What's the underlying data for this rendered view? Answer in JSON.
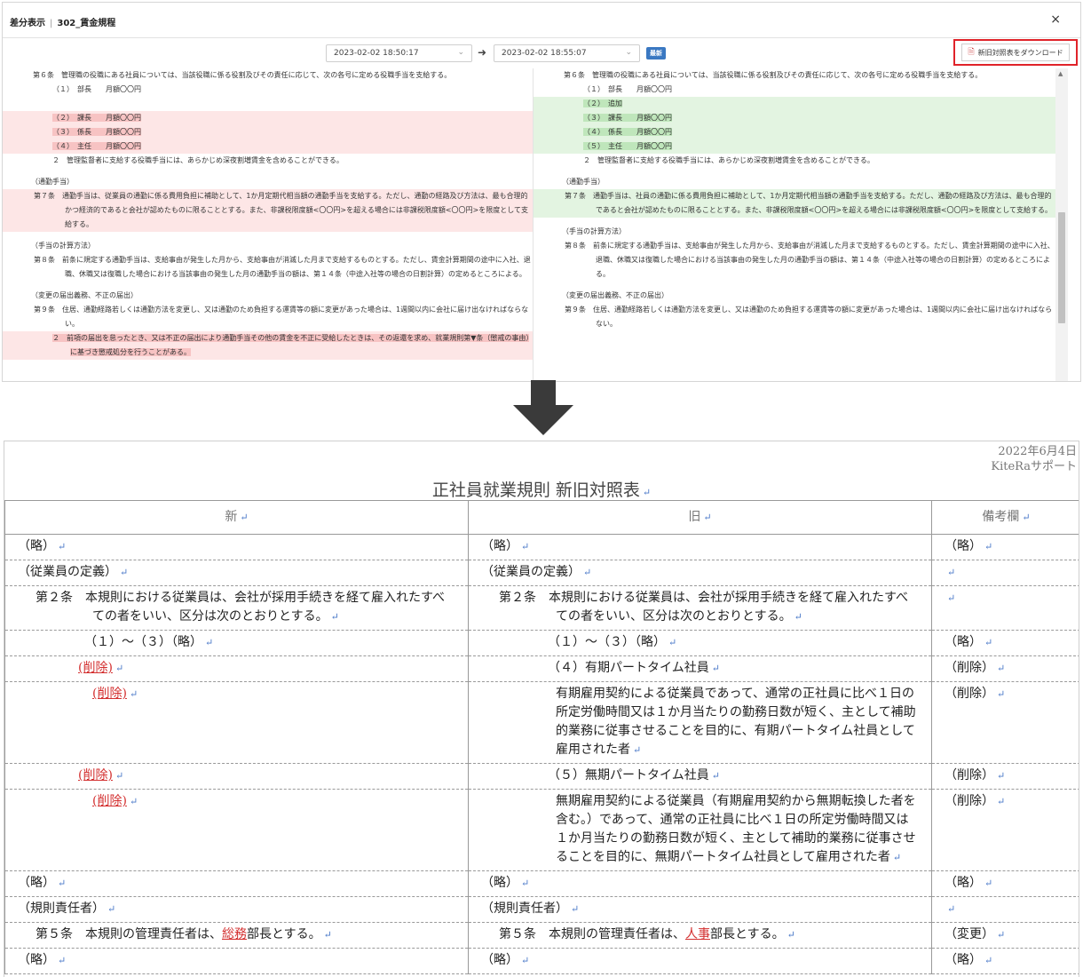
{
  "dialog": {
    "title": "差分表示",
    "doc_name": "302_賃金規程",
    "close_glyph": "×",
    "date_from": "2023-02-02 18:50:17",
    "date_to": "2023-02-02 18:55:07",
    "latest_badge": "最新",
    "download_label": "新旧対照表をダウンロード"
  },
  "left_pane": {
    "art6": "第６条　管理職の役職にある社員については、当該役職に係る役割及びその責任に応じて、次の各号に定める役職手当を支給する。",
    "l1": "（１）　部長　　月額〇〇円",
    "l2": "（２）　課長　　月額〇〇円",
    "l3": "（３）　係長　　月額〇〇円",
    "l4": "（４）　主任　　月額〇〇円",
    "art6_2": "２　管理監督者に支給する役職手当には、あらかじめ深夜割増賃金を含めることができる。",
    "sec7": "（通勤手当）",
    "art7": "第７条　通勤手当は、従業員の通勤に係る費用負担に補助として、1か月定期代相当額の通勤手当を支給する。ただし、通勤の経路及び方法は、最も合理的かつ経済的であると会社が認めたものに限ることとする。また、非課税限度額<〇〇円>を超える場合には非課税限度額<〇〇円>を限度として支給する。",
    "sec8": "（手当の計算方法）",
    "art8": "第８条　前条に規定する通勤手当は、支給事由が発生した月から、支給事由が消滅した月まで支給するものとする。ただし、賃金計算期間の途中に入社、退職、休職又は復職した場合における当該事由の発生した月の通勤手当の額は、第１４条（中途入社等の場合の日割計算）の定めるところによる。",
    "sec9": "（変更の届出義務、不正の届出）",
    "art9": "第９条　住居、通勤経路若しくは通勤方法を変更し、又は通勤のため負担する運賃等の額に変更があった場合は、1週間以内に会社に届け出なければならない。",
    "art9_2": "２　前項の届出を怠ったとき、又は不正の届出により通勤手当その他の賃金を不正に受給したときは、その返還を求め、就業規則第▼条（懲戒の事由）に基づき懲戒処分を行うことがある。"
  },
  "right_pane": {
    "art6": "第６条　管理職の役職にある社員については、当該役職に係る役割及びその責任に応じて、次の各号に定める役職手当を支給する。",
    "l1": "（１）　部長　　月額〇〇円",
    "l2": "（２）　追加",
    "l3": "（３）　課長　　月額〇〇円",
    "l4": "（４）　係長　　月額〇〇円",
    "l5": "（５）　主任　　月額〇〇円",
    "art6_2": "２　管理監督者に支給する役職手当には、あらかじめ深夜割増賃金を含めることができる。",
    "sec7": "（通勤手当）",
    "art7": "第７条　通勤手当は、社員の通勤に係る費用負担に補助として、1か月定期代相当額の通勤手当を支給する。ただし、通勤の経路及び方法は、最も合理的であると会社が認めたものに限ることとする。また、非課税限度額<〇〇円>を超える場合には非課税限度額<〇〇円>を限度として支給する。",
    "sec8": "（手当の計算方法）",
    "art8": "第８条　前条に規定する通勤手当は、支給事由が発生した月から、支給事由が消滅した月まで支給するものとする。ただし、賃金計算期間の途中に入社、退職、休職又は復職した場合における当該事由の発生した月の通勤手当の額は、第１４条（中途入社等の場合の日割計算）の定めるところによる。",
    "sec9": "（変更の届出義務、不正の届出）",
    "art9": "第９条　住居、通勤経路若しくは通勤方法を変更し、又は通勤のため負担する運賃等の額に変更があった場合は、1週間以内に会社に届け出なければならない。"
  },
  "document": {
    "date": "2022年6月4日",
    "author": "KiteRaサポート",
    "title": "正社員就業規則 新旧対照表",
    "return_mark": "↵",
    "headers": {
      "new": "新",
      "old": "旧",
      "note": "備考欄"
    },
    "rows": {
      "r1": {
        "new": "（略）",
        "old": "（略）",
        "note": "（略）"
      },
      "r2": {
        "new": "（従業員の定義）",
        "old": "（従業員の定義）",
        "note": ""
      },
      "r3": {
        "new": "第２条　本規則における従業員は、会社が採用手続きを経て雇入れたすべての者をいい、区分は次のとおりとする。",
        "old": "第２条　本規則における従業員は、会社が採用手続きを経て雇入れたすべての者をいい、区分は次のとおりとする。",
        "note": ""
      },
      "r4": {
        "new": "（１）～（３）（略）",
        "old": "（１）～（３）（略）",
        "note": "（略）"
      },
      "r5": {
        "new": "(削除)",
        "old": "（４）有期パートタイム社員",
        "note": "（削除）"
      },
      "r6": {
        "new": "(削除)",
        "old": "有期雇用契約による従業員であって、通常の正社員に比べ１日の所定労働時間又は１か月当たりの勤務日数が短く、主として補助的業務に従事させることを目的に、有期パートタイム社員として雇用された者",
        "note": "（削除）"
      },
      "r7": {
        "new": "(削除)",
        "old": "（５）無期パートタイム社員",
        "note": "（削除）"
      },
      "r8": {
        "new": "(削除)",
        "old": "無期雇用契約による従業員（有期雇用契約から無期転換した者を含む。）であって、通常の正社員に比べ１日の所定労働時間又は１か月当たりの勤務日数が短く、主として補助的業務に従事させることを目的に、無期パートタイム社員として雇用された者",
        "note": "（削除）"
      },
      "r9": {
        "new": "（略）",
        "old": "（略）",
        "note": "（略）"
      },
      "r10": {
        "new": "（規則責任者）",
        "old": "（規則責任者）",
        "note": ""
      },
      "r11": {
        "new_pre": "第５条　本規則の管理責任者は、",
        "new_chg": "総務",
        "new_post": "部長とする。",
        "old_pre": "第５条　本規則の管理責任者は、",
        "old_chg": "人事",
        "old_post": "部長とする。",
        "note": "（変更）"
      },
      "r12": {
        "new": "（略）",
        "old": "（略）",
        "note": "（略）"
      }
    }
  }
}
